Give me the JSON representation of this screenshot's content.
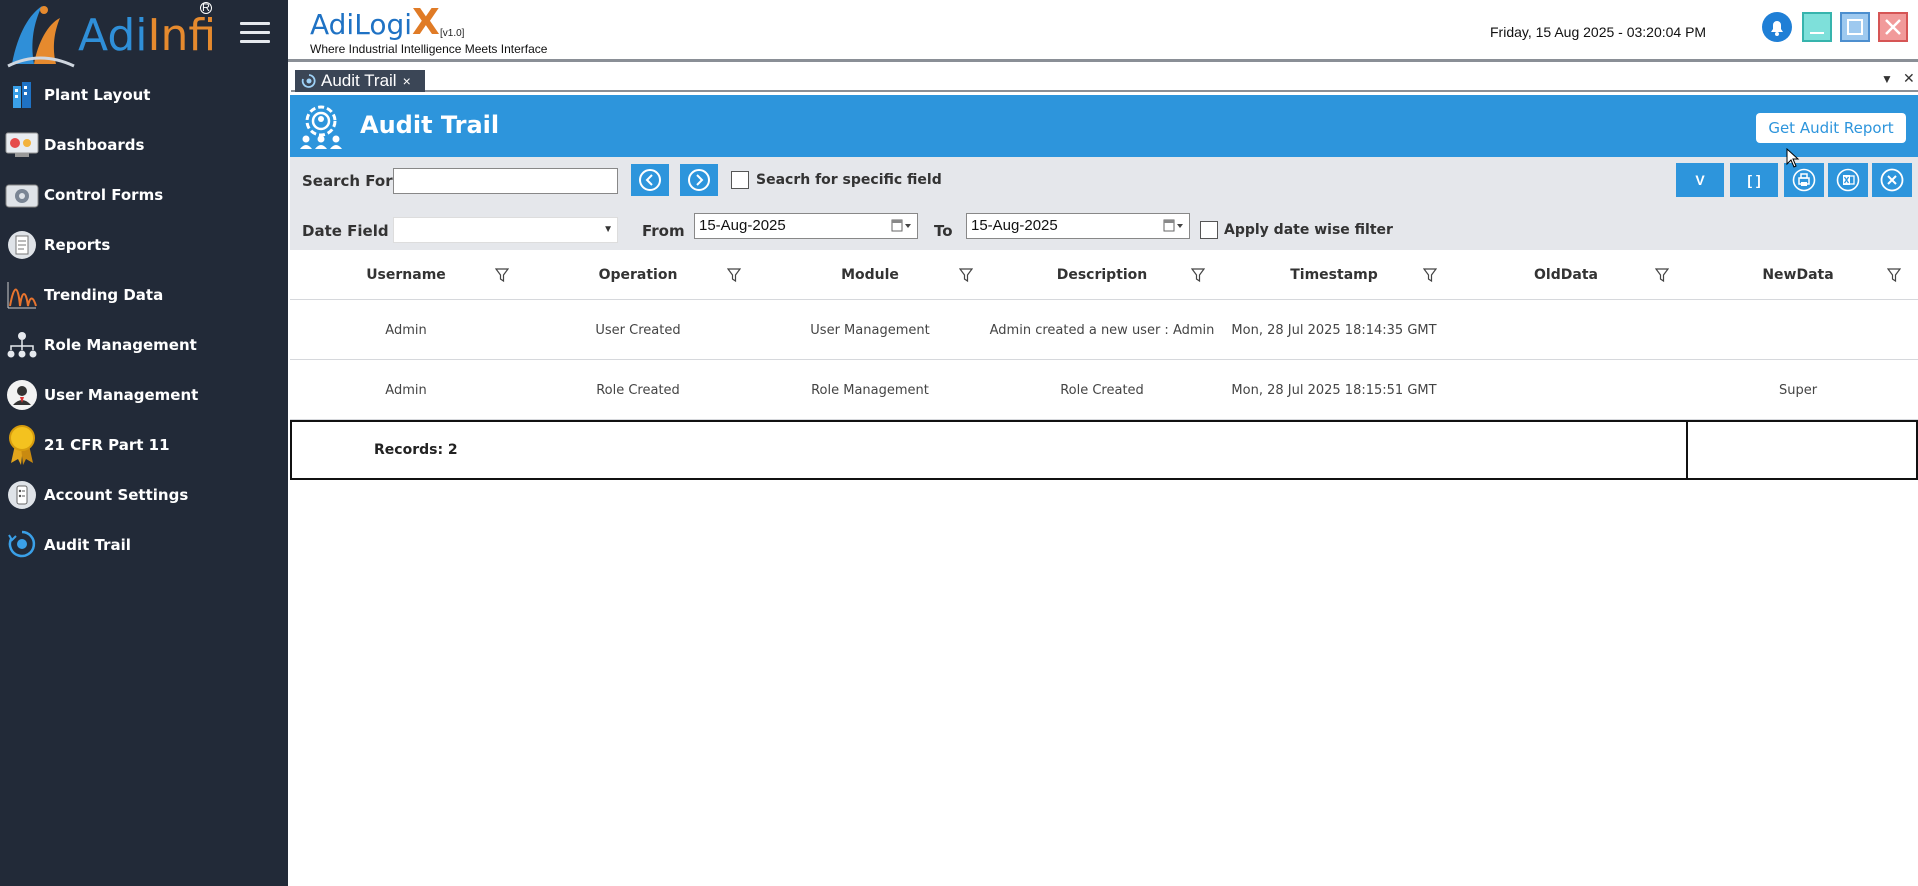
{
  "app": {
    "logo_text_a": "Adi",
    "logo_text_b": "Infi",
    "logo_reg": "R",
    "brand_name": "AdiLogi",
    "brand_x": "X",
    "brand_version": "[v1.0]",
    "brand_tagline": "Where Industrial Intelligence Meets Interface",
    "datetime": "Friday, 15 Aug 2025 - 03:20:04 PM"
  },
  "sidebar": {
    "items": [
      {
        "label": "Plant Layout",
        "icon": "building-icon"
      },
      {
        "label": "Dashboards",
        "icon": "dashboard-icon"
      },
      {
        "label": "Control Forms",
        "icon": "control-forms-icon"
      },
      {
        "label": "Reports",
        "icon": "report-icon"
      },
      {
        "label": "Trending Data",
        "icon": "trend-icon"
      },
      {
        "label": "Role Management",
        "icon": "role-icon"
      },
      {
        "label": "User Management",
        "icon": "user-icon"
      },
      {
        "label": "21 CFR Part 11",
        "icon": "badge-icon"
      },
      {
        "label": "Account Settings",
        "icon": "settings-icon"
      },
      {
        "label": "Audit Trail",
        "icon": "audit-icon"
      }
    ]
  },
  "tabs": [
    {
      "label": "Audit Trail",
      "close": "×"
    }
  ],
  "tabstrip": {
    "menu": "▼",
    "close_all": "✕"
  },
  "page": {
    "title": "Audit Trail",
    "audit_button": "Get Audit Report"
  },
  "filters": {
    "search_label": "Search For",
    "search_value": "",
    "specific_field_label": "Seacrh for specific field",
    "date_field_label": "Date Field",
    "date_field_value": "",
    "from_label": "From",
    "from_value": "15-Aug-2025",
    "to_label": "To",
    "to_value": "15-Aug-2025",
    "date_filter_label": "Apply date wise filter"
  },
  "toolbar": {
    "v_label": "V",
    "bracket_label": "[ ]"
  },
  "grid": {
    "columns": [
      "Username",
      "Operation",
      "Module",
      "Description",
      "Timestamp",
      "OldData",
      "NewData"
    ],
    "rows": [
      [
        "Admin",
        "User Created",
        "User Management",
        "Admin created a new user : Admin",
        "Mon, 28 Jul 2025 18:14:35 GMT",
        "",
        ""
      ],
      [
        "Admin",
        "Role Created",
        "Role Management",
        "Role Created",
        "Mon, 28 Jul 2025 18:15:51 GMT",
        "",
        "Super"
      ]
    ],
    "records_label": "Records: 2"
  },
  "colors": {
    "sidebar_bg": "#222a38",
    "accent": "#2d95dc",
    "filter_bg": "#e5e7eb"
  }
}
